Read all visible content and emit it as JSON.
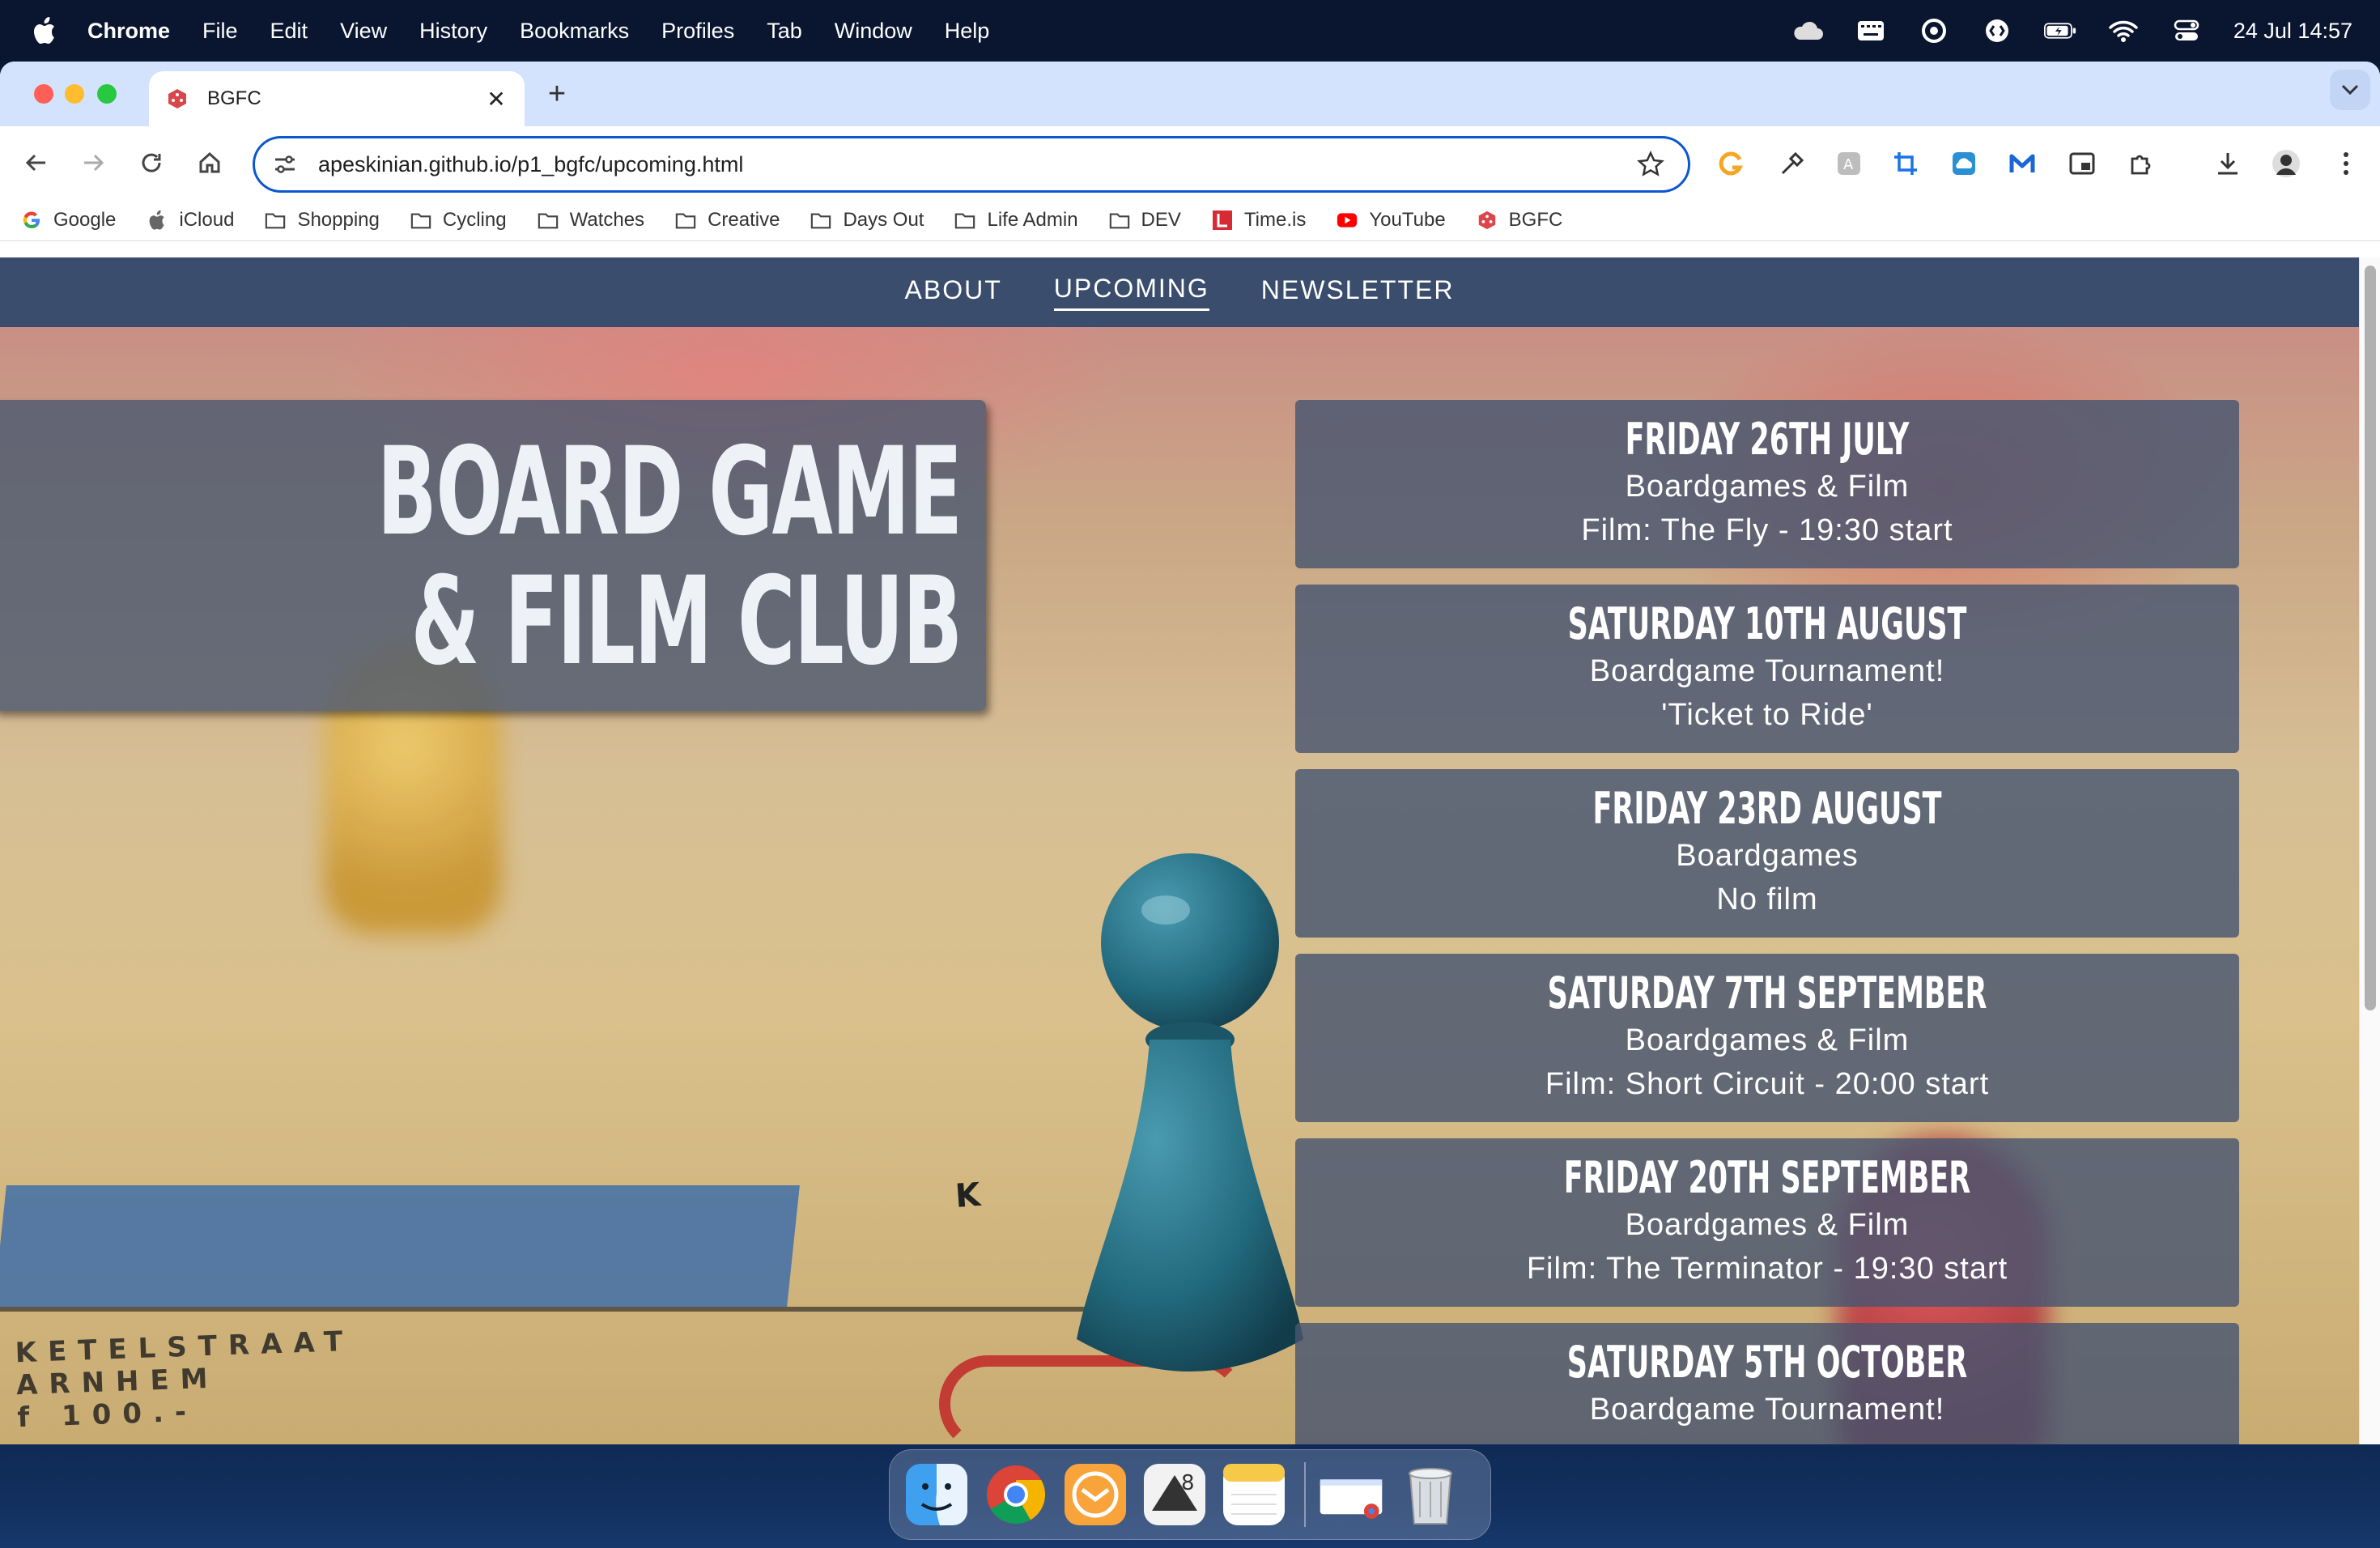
{
  "menubar": {
    "app_name": "Chrome",
    "items": [
      "File",
      "Edit",
      "View",
      "History",
      "Bookmarks",
      "Profiles",
      "Tab",
      "Window",
      "Help"
    ],
    "clock": "24 Jul  14:57"
  },
  "browser": {
    "tab_title": "BGFC",
    "url": "apeskinian.github.io/p1_bgfc/upcoming.html",
    "bookmarks": [
      {
        "label": "Google",
        "icon": "google-icon"
      },
      {
        "label": "iCloud",
        "icon": "apple-icon"
      },
      {
        "label": "Shopping",
        "icon": "folder-icon"
      },
      {
        "label": "Cycling",
        "icon": "folder-icon"
      },
      {
        "label": "Watches",
        "icon": "folder-icon"
      },
      {
        "label": "Creative",
        "icon": "folder-icon"
      },
      {
        "label": "Days Out",
        "icon": "folder-icon"
      },
      {
        "label": "Life Admin",
        "icon": "folder-icon"
      },
      {
        "label": "DEV",
        "icon": "folder-icon"
      },
      {
        "label": "Time.is",
        "icon": "timeis-icon"
      },
      {
        "label": "YouTube",
        "icon": "youtube-icon"
      },
      {
        "label": "BGFC",
        "icon": "dice-icon"
      }
    ]
  },
  "site": {
    "nav": {
      "about": "ABOUT",
      "upcoming": "UPCOMING",
      "newsletter": "NEWSLETTER"
    },
    "title": "BOARD GAME\n& FILM CLUB",
    "board_text": "KETELSTRAAT\nARNHEM\nf 100.-",
    "board_letter": "K",
    "events": [
      {
        "date": "FRIDAY 26TH JULY",
        "line1": "Boardgames & Film",
        "line2": "Film: The Fly - 19:30 start"
      },
      {
        "date": "SATURDAY 10TH AUGUST",
        "line1": "Boardgame Tournament!",
        "line2": "'Ticket to Ride'"
      },
      {
        "date": "FRIDAY 23RD AUGUST",
        "line1": "Boardgames",
        "line2": "No film"
      },
      {
        "date": "SATURDAY 7TH SEPTEMBER",
        "line1": "Boardgames & Film",
        "line2": "Film: Short Circuit - 20:00 start"
      },
      {
        "date": "FRIDAY 20TH SEPTEMBER",
        "line1": "Boardgames & Film",
        "line2": "Film: The Terminator - 19:30 start"
      },
      {
        "date": "SATURDAY 5TH OCTOBER",
        "line1": "Boardgame Tournament!",
        "line2": ""
      }
    ]
  },
  "colors": {
    "nav_bg": "#3a4d6c",
    "card_bg": "rgba(72,86,112,0.82)",
    "omnibox_border": "#0b57d0",
    "tabstrip_bg": "#d3e3fd"
  }
}
